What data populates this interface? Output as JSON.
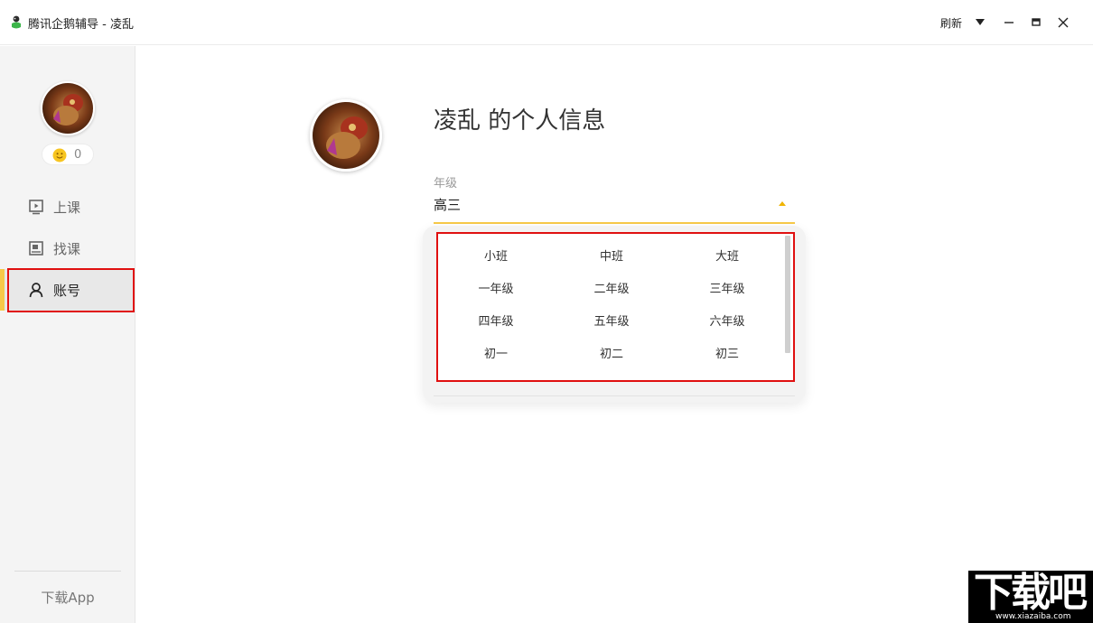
{
  "window": {
    "title": "腾讯企鹅辅导 - 凌乱",
    "refresh_label": "刷新"
  },
  "sidebar": {
    "coin_count": "0",
    "items": [
      {
        "label": "上课",
        "icon": "play-screen-icon"
      },
      {
        "label": "找课",
        "icon": "book-icon"
      },
      {
        "label": "账号",
        "icon": "user-icon"
      }
    ],
    "active_index": 2,
    "download_label": "下载App"
  },
  "profile": {
    "title": "凌乱 的个人信息",
    "grade_label": "年级",
    "grade_value": "高三"
  },
  "dropdown": {
    "options": [
      "小班",
      "中班",
      "大班",
      "一年级",
      "二年级",
      "三年级",
      "四年级",
      "五年级",
      "六年级",
      "初一",
      "初二",
      "初三"
    ]
  },
  "colors": {
    "accent": "#f7c948",
    "highlight_box": "#e01010",
    "sidebar_bg": "#f4f4f4"
  },
  "watermark": {
    "text": "下载吧",
    "url_text": "www.xiazaiba.com"
  }
}
